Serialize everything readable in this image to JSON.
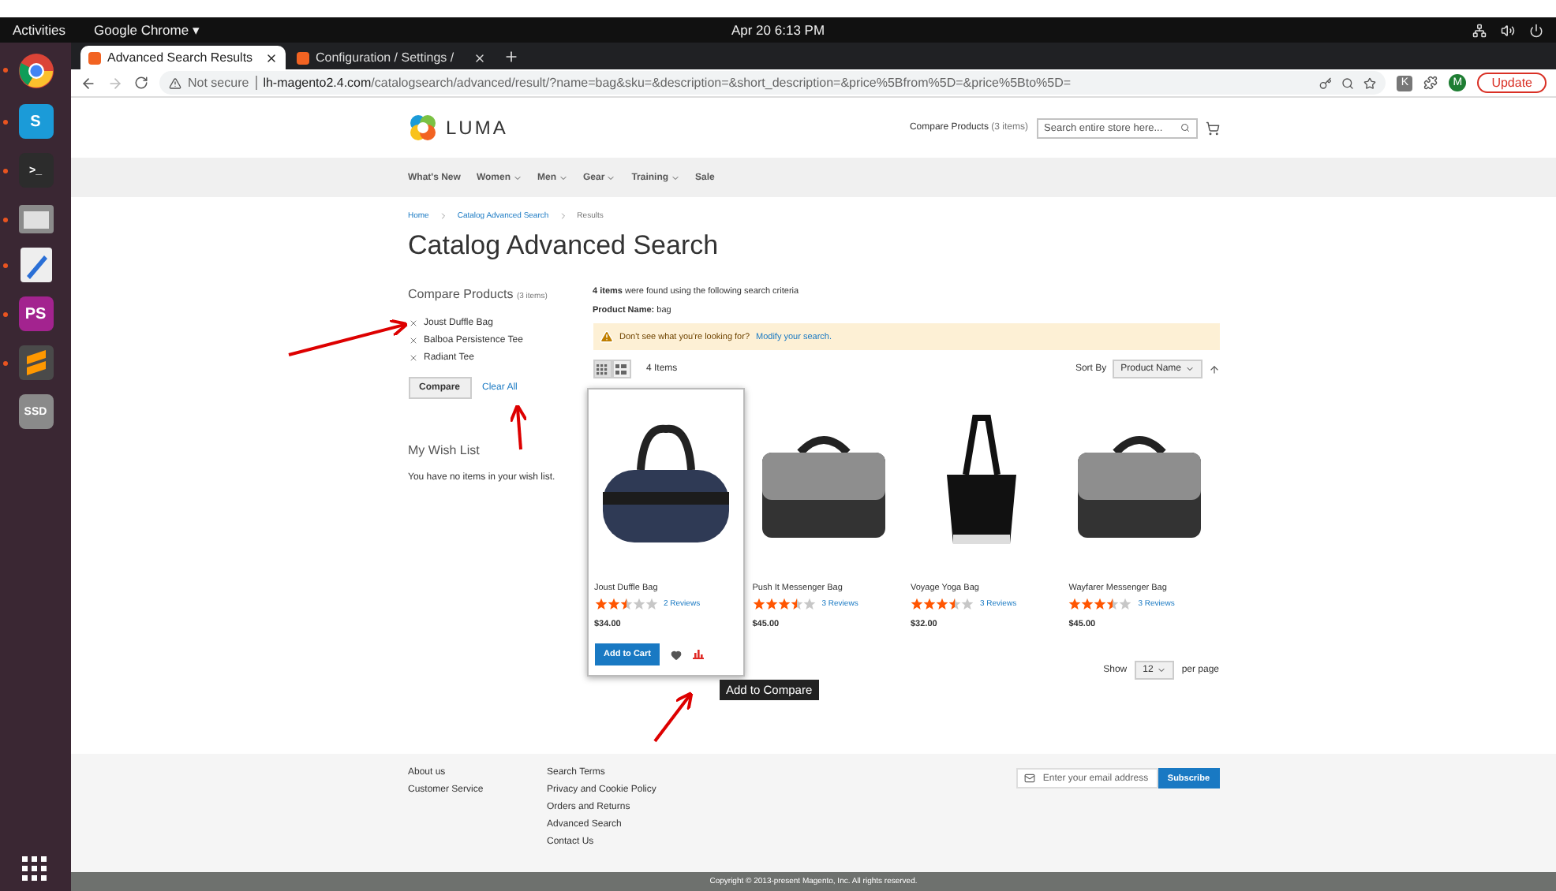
{
  "system_bar": {
    "activities": "Activities",
    "app_menu": "Google Chrome ▾",
    "clock": "Apr 20  6:13 PM"
  },
  "dock": [
    {
      "kind": "chrome",
      "running": true
    },
    {
      "kind": "letter",
      "label": "S",
      "color": "#1b9bd8",
      "running": true
    },
    {
      "kind": "terminal",
      "label": ">_",
      "running": true
    },
    {
      "kind": "files",
      "running": true
    },
    {
      "kind": "editor",
      "running": true
    },
    {
      "kind": "letter",
      "label": "PS",
      "color": "#a3238f",
      "running": true
    },
    {
      "kind": "sublime",
      "running": true
    },
    {
      "kind": "letter",
      "label": "SSD",
      "color": "#8a8a8a",
      "running": false
    }
  ],
  "browser": {
    "tabs": [
      {
        "title": "Advanced Search Results",
        "selected": true
      },
      {
        "title": "Configuration / Settings /",
        "selected": false
      }
    ],
    "security": "Not secure",
    "url_host": "lh-magento2.4.com",
    "url_path": "/catalogsearch/advanced/result/?name=bag&sku=&description=&short_description=&price%5Bfrom%5D=&price%5Bto%5D=",
    "extension_letter": "K",
    "profile": "M",
    "update": "Update"
  },
  "header": {
    "logo": "LUMA",
    "compare_label": "Compare Products",
    "compare_count": "(3 items)",
    "search_placeholder": "Search entire store here..."
  },
  "nav": [
    {
      "label": "What's New",
      "dropdown": false
    },
    {
      "label": "Women",
      "dropdown": true
    },
    {
      "label": "Men",
      "dropdown": true
    },
    {
      "label": "Gear",
      "dropdown": true
    },
    {
      "label": "Training",
      "dropdown": true
    },
    {
      "label": "Sale",
      "dropdown": false
    }
  ],
  "breadcrumbs": [
    {
      "label": "Home",
      "current": false
    },
    {
      "label": "Catalog Advanced Search",
      "current": false
    },
    {
      "label": "Results",
      "current": true
    }
  ],
  "title": "Catalog Advanced Search",
  "sidebar": {
    "compare_title": "Compare Products",
    "compare_count": "(3 items)",
    "compare_items": [
      "Joust Duffle Bag",
      "Balboa Persistence Tee",
      "Radiant Tee"
    ],
    "compare_button": "Compare",
    "clear_all": "Clear All",
    "wishlist_title": "My Wish List",
    "wishlist_empty": "You have no items in your wish list."
  },
  "results": {
    "summary": "**4 items** were found using the following search criteria",
    "criteria": "**Product Name:** bag",
    "notice_text": "Don't see what you're looking for?",
    "notice_link": "Modify your search.",
    "view_modes": [
      {
        "kind": "grid",
        "selected": true
      },
      {
        "kind": "list",
        "selected": false
      }
    ],
    "count": "4 Items",
    "sort_label": "Sort By",
    "sort_value": "Product Name",
    "products": [
      {
        "name": "Joust Duffle Bag",
        "kind": "duffle",
        "stars": 2.5,
        "reviews": "2  Reviews",
        "price": "$34.00",
        "hovered": true
      },
      {
        "name": "Push It Messenger Bag",
        "kind": "messenger",
        "stars": 3.5,
        "reviews": "3  Reviews",
        "price": "$45.00",
        "hovered": false
      },
      {
        "name": "Voyage Yoga Bag",
        "kind": "tote",
        "stars": 3.5,
        "reviews": "3  Reviews",
        "price": "$32.00",
        "hovered": false
      },
      {
        "name": "Wayfarer Messenger Bag",
        "kind": "messenger",
        "stars": 3.5,
        "reviews": "3  Reviews",
        "price": "$45.00",
        "hovered": false
      }
    ],
    "add_to_cart": "Add to Cart",
    "tooltip": "Add to Compare",
    "show_label": "Show",
    "limit": "12",
    "per_page": "per page"
  },
  "footer": {
    "columns": [
      [
        "About us",
        "Customer Service"
      ],
      [
        "Search Terms",
        "Privacy and Cookie Policy",
        "Orders and Returns",
        "Advanced Search",
        "Contact Us"
      ]
    ],
    "newsletter_placeholder": "Enter your email address",
    "subscribe": "Subscribe",
    "copyright": "Copyright © 2013-present Magento, Inc. All rights reserved."
  }
}
